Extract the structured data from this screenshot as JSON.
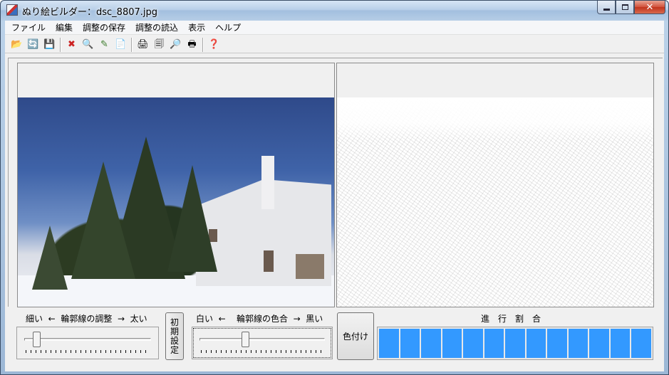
{
  "window": {
    "title": "ぬり絵ビルダー：dsc_8807.jpg",
    "close_glyph": "✕"
  },
  "menu": [
    "ファイル",
    "編集",
    "調整の保存",
    "調整の読込",
    "表示",
    "ヘルプ"
  ],
  "toolbar": {
    "icons": [
      {
        "name": "open-folder-icon",
        "glyph": "📂"
      },
      {
        "name": "reload-icon",
        "glyph": "🔄"
      },
      {
        "name": "save-icon",
        "glyph": "💾"
      },
      {
        "name": "close-image-icon",
        "glyph": "✖"
      },
      {
        "name": "zoom-icon",
        "glyph": "🔍"
      },
      {
        "name": "edit-icon",
        "glyph": "✎"
      },
      {
        "name": "export-icon",
        "glyph": "📄"
      },
      {
        "name": "print-icon",
        "glyph": "🖨"
      },
      {
        "name": "print-setup-icon",
        "glyph": "🗐"
      },
      {
        "name": "print-preview-icon",
        "glyph": "🔎"
      },
      {
        "name": "printer-config-icon",
        "glyph": "🖶"
      },
      {
        "name": "help-icon",
        "glyph": "❓"
      }
    ]
  },
  "controls": {
    "outline_width_label": "細い  ←  輪郭線の調整  →  太い",
    "outline_width_value": 0.07,
    "reset_button_label": "初\n期\n設\n定",
    "outline_color_label": "白い  ←    輪郭線の色合  →  黒い",
    "outline_color_value": 0.36,
    "colorize_button_label": "色付け",
    "progress_label": "進　行　割　合",
    "progress_segments": 13,
    "progress_value": 1.0
  },
  "colors": {
    "progress": "#3399ff",
    "close_button": "#c1341c"
  }
}
